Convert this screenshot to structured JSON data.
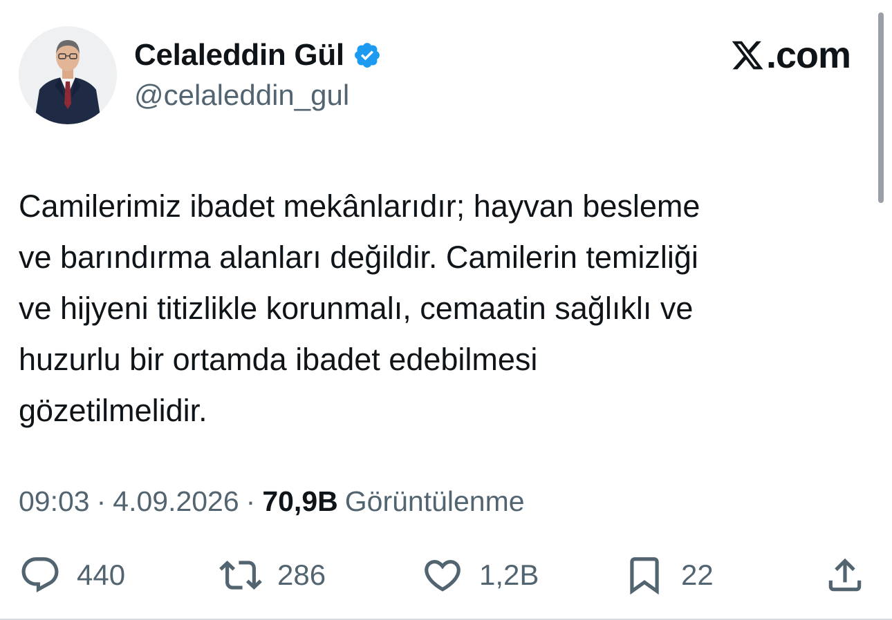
{
  "author": {
    "display_name": "Celaleddin Gül",
    "handle": "@celaleddin_gul",
    "verified": true,
    "verified_color": "#1d9bf0"
  },
  "brand": {
    "logo_icon": "x-logo-icon",
    "suffix": ".com"
  },
  "tweet": {
    "text": "Camilerimiz ibadet mekânlarıdır; hayvan besleme\nve barındırma alanları değildir. Camilerin temizliği\nve hijyeni titizlikle korunmalı, cemaatin sağlıklı ve\nhuzurlu bir ortamda ibadet edebilmesi\ngözetilmelidir."
  },
  "meta": {
    "time": "09:03",
    "separator": "·",
    "date": "4.09.2026",
    "views_count": "70,9B",
    "views_label": "Görüntülenme"
  },
  "actions": {
    "reply": {
      "icon": "reply-icon",
      "count": "440"
    },
    "retweet": {
      "icon": "retweet-icon",
      "count": "286"
    },
    "like": {
      "icon": "heart-icon",
      "count": "1,2B"
    },
    "bookmark": {
      "icon": "bookmark-icon",
      "count": "22"
    },
    "share": {
      "icon": "share-icon"
    }
  },
  "colors": {
    "text_primary": "#0f1419",
    "text_secondary": "#536471",
    "background": "#ffffff"
  }
}
